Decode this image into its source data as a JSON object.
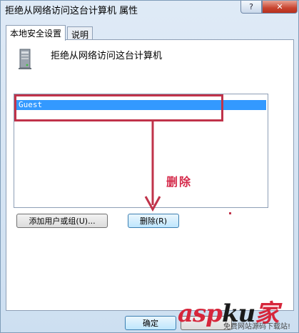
{
  "window": {
    "title": "拒绝从网络访问这台计算机 属性",
    "help_label": "?",
    "close_label": "✕"
  },
  "tabs": [
    {
      "label": "本地安全设置",
      "active": true
    },
    {
      "label": "说明",
      "active": false
    }
  ],
  "policy": {
    "icon": "server-icon",
    "title": "拒绝从网络访问这台计算机"
  },
  "list": {
    "items": [
      "Guest"
    ],
    "selected_index": 0
  },
  "buttons": {
    "add": "添加用户或组(U)...",
    "delete": "删除(R)",
    "ok": "确定",
    "cancel": ""
  },
  "annotation": {
    "text": "删除",
    "color": "#d52a4a"
  },
  "watermark": {
    "main_a": "asp",
    "main_b": "ku",
    "main_c": "家",
    "sub": "免费网站源码下载站!"
  },
  "colors": {
    "accent": "#3399ff",
    "highlight": "#c0334a"
  }
}
